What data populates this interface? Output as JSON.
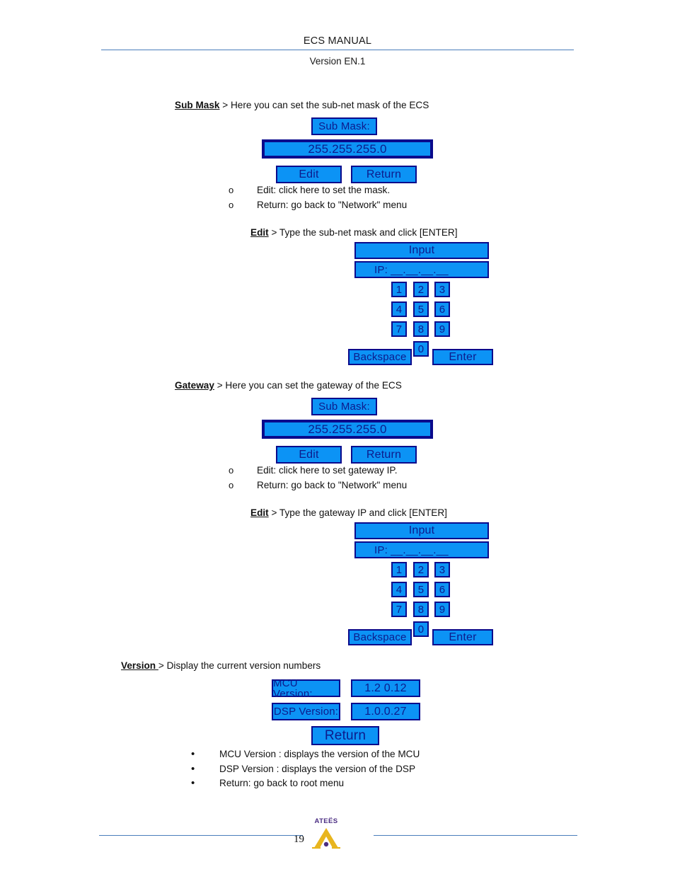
{
  "header": {
    "title": "ECS  MANUAL",
    "version": "Version EN.1"
  },
  "sections": {
    "sub_mask": {
      "heading_bold": "Sub Mask",
      "heading_rest": " > Here you can set the sub-net mask of the ECS",
      "panel": {
        "label": "Sub Mask:",
        "value": "255.255.255.0",
        "edit_button": "Edit",
        "return_button": "Return"
      },
      "bullets": [
        {
          "marker": "o",
          "text": "Edit: click here to set the mask."
        },
        {
          "marker": "o",
          "text": "Return: go back to \"Network\" menu"
        }
      ],
      "edit_line_bold": "Edit",
      "edit_line_rest": " > Type the sub-net mask and click [ENTER]",
      "keypad": {
        "title": "Input",
        "ip_field": "IP:  __.__.__.__",
        "keys": [
          "1",
          "2",
          "3",
          "4",
          "5",
          "6",
          "7",
          "8",
          "9"
        ],
        "zero": "0",
        "backspace": "Backspace",
        "enter": "Enter"
      }
    },
    "gateway": {
      "heading_bold": "Gateway",
      "heading_rest": " > Here you can set the gateway of the ECS",
      "panel": {
        "label": "Sub Mask:",
        "value": "255.255.255.0",
        "edit_button": "Edit",
        "return_button": "Return"
      },
      "bullets": [
        {
          "marker": "o",
          "text": "Edit: click here to set gateway IP."
        },
        {
          "marker": "o",
          "text": "Return: go back to \"Network\" menu"
        }
      ],
      "edit_line_bold": "Edit",
      "edit_line_rest": " > Type the gateway IP and click [ENTER]",
      "keypad": {
        "title": "Input",
        "ip_field": "IP:  __.__.__.__",
        "keys": [
          "1",
          "2",
          "3",
          "4",
          "5",
          "6",
          "7",
          "8",
          "9"
        ],
        "zero": "0",
        "backspace": "Backspace",
        "enter": "Enter"
      }
    },
    "version": {
      "heading_bold": "Version ",
      "heading_rest": "> Display the current version numbers",
      "panel": {
        "mcu_label": "MCU Version:",
        "mcu_value": "1.2 0.12",
        "dsp_label": "DSP Version:",
        "dsp_value": "1.0.0.27",
        "return_button": "Return"
      },
      "bullets": [
        {
          "marker": "•",
          "text": "MCU Version : displays the version of the MCU"
        },
        {
          "marker": "•",
          "text": "DSP Version : displays the version of the DSP"
        },
        {
          "marker": "•",
          "text": "Return: go back to root menu"
        }
      ]
    }
  },
  "footer": {
    "page_number": "19",
    "logo_text": "ATEËS"
  },
  "colors": {
    "widget_fill": "#0c93f5",
    "widget_border": "#0a0a8c",
    "widget_text": "#0d1b8c",
    "rule": "#4a7ebb",
    "logo_purple": "#4b2e83",
    "logo_gold": "#e8b51e"
  }
}
